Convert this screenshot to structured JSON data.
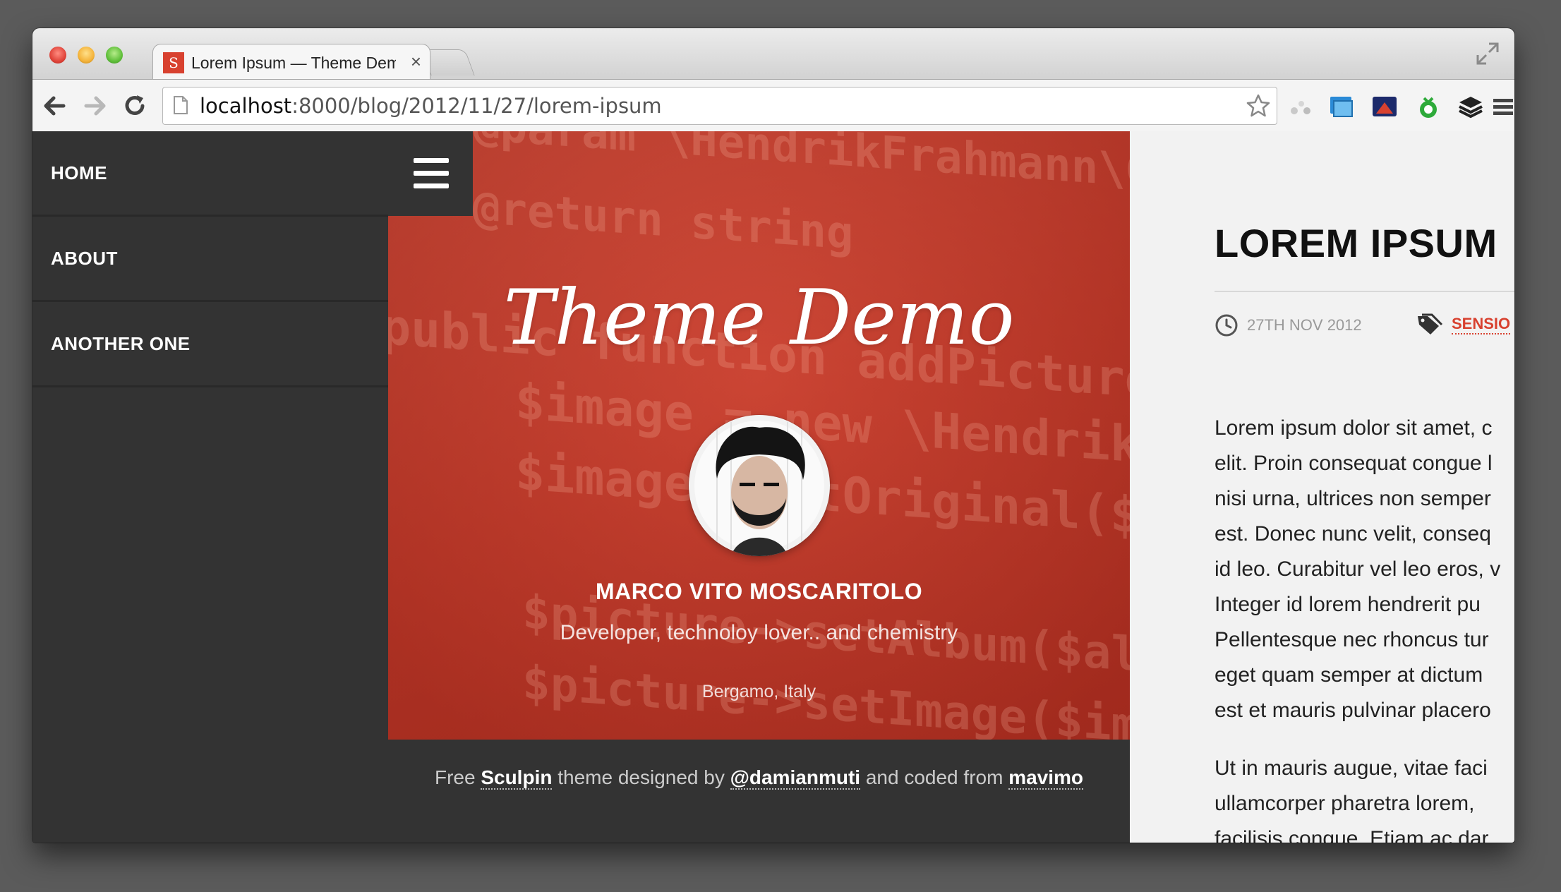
{
  "browser": {
    "tab_title": "Lorem Ipsum — Theme Demo",
    "tab_favicon": "S",
    "url_host": "localhost",
    "url_path": ":8000/blog/2012/11/27/lorem-ipsum"
  },
  "sidebar": {
    "items": [
      {
        "label": "HOME"
      },
      {
        "label": "ABOUT"
      },
      {
        "label": "ANOTHER ONE"
      }
    ]
  },
  "hero": {
    "site_title": "Theme Demo",
    "author_name": "MARCO VITO MOSCARITOLO",
    "author_bio": "Developer, technoloy lover.. and chemistry",
    "author_location": "Bergamo, Italy",
    "code_lines": [
      "@param   \\HendrikFrahmann\\Gal",
      "@return string",
      "public function addPictureActi",
      "$image = new \\HendrikFrahm",
      "$image->setOriginal($file)",
      "$picture->setAlbum($album);",
      "$picture->setImage($image);"
    ]
  },
  "footer": {
    "text_free": "Free",
    "link_sculpin": "Sculpin",
    "text_designed": "theme designed by",
    "link_designer": "@damianmuti",
    "text_coded": "and coded from",
    "link_coder": "mavimo"
  },
  "article": {
    "title": "LOREM IPSUM",
    "date": "27TH NOV 2012",
    "tag": "SENSIO",
    "paragraph1": [
      "Lorem ipsum dolor sit amet, c",
      "elit. Proin consequat congue l",
      "nisi urna, ultrices non semper",
      "est. Donec nunc velit, conseq",
      "id leo. Curabitur vel leo eros, v",
      "Integer id lorem hendrerit pu",
      "Pellentesque nec rhoncus tur",
      "eget quam semper at dictum",
      "est et mauris pulvinar placero"
    ],
    "paragraph2": [
      "Ut in mauris augue, vitae faci",
      "ullamcorper pharetra lorem,",
      "facilisis congue. Etiam ac dar"
    ]
  },
  "colors": {
    "accent": "#d8412f",
    "sidebar_bg": "#333333",
    "article_bg": "#f2f2f2"
  },
  "icons": [
    "back-icon",
    "forward-icon",
    "reload-icon",
    "page-icon",
    "star-icon",
    "menu-icon",
    "clock-icon",
    "tag-icon",
    "fullscreen-icon",
    "chrome-menu-icon"
  ]
}
